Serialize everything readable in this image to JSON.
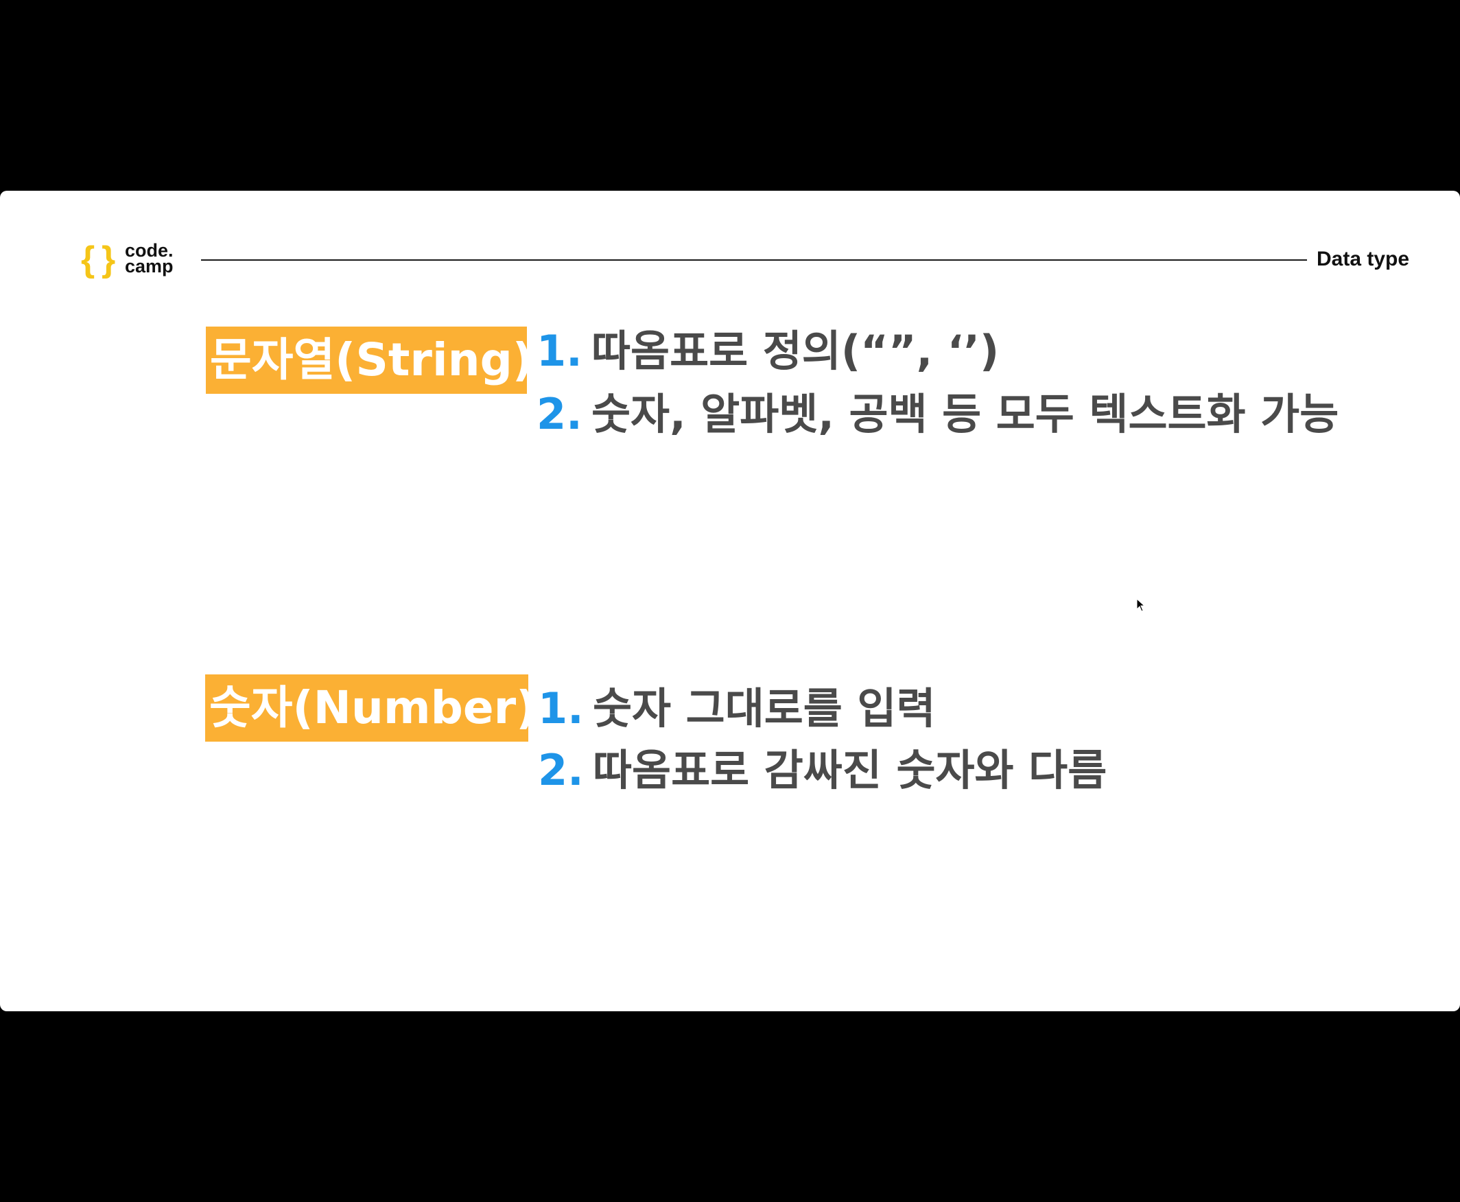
{
  "header": {
    "logo_line1": "code.",
    "logo_line2": "camp",
    "title": "Data type",
    "logo_color": "#f5c518"
  },
  "sections": [
    {
      "label": "문자열(String)",
      "items": [
        {
          "number": "1.",
          "text": "따옴표로 정의(“”, ‘’)"
        },
        {
          "number": "2.",
          "text": "숫자, 알파벳, 공백 등 모두 텍스트화 가능"
        }
      ]
    },
    {
      "label": "숫자(Number)",
      "items": [
        {
          "number": "1.",
          "text": "숫자 그대로를 입력"
        },
        {
          "number": "2.",
          "text": "따옴표로 감싸진 숫자와 다름"
        }
      ]
    }
  ],
  "colors": {
    "label_background": "#fbb034",
    "number_color": "#1e94e8",
    "item_text": "#4a4a4a"
  }
}
